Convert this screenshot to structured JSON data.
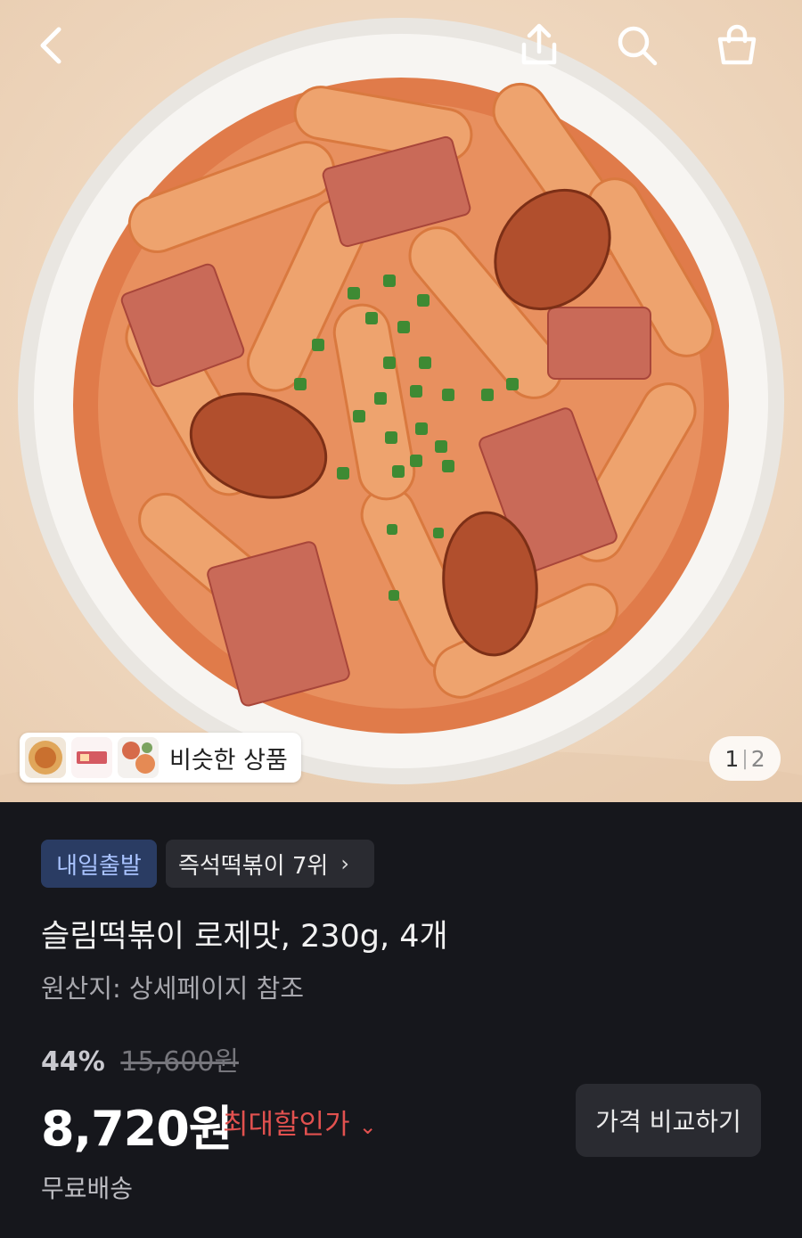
{
  "header": {
    "back_icon": "chevron-left-icon",
    "share_icon": "share-icon",
    "search_icon": "search-icon",
    "cart_icon": "shopping-bag-icon"
  },
  "hero": {
    "similar_products_label": "비슷한 상품",
    "page_current": "1",
    "page_separator": "|",
    "page_total": "2"
  },
  "badges": {
    "shipping": "내일출발",
    "ranking": "즉석떡볶이 7위",
    "ranking_chevron": "›"
  },
  "product": {
    "title": "슬림떡볶이 로제맛, 230g, 4개",
    "origin": "원산지: 상세페이지 참조"
  },
  "pricing": {
    "discount_percent": "44%",
    "original_price": "15,600원",
    "price": "8,720원",
    "max_discount_label": "최대할인가",
    "max_discount_chevron": "⌄",
    "compare_button": "가격 비교하기",
    "delivery": "무료배송"
  },
  "colors": {
    "background": "#16171c",
    "discount_accent": "#e2514f",
    "shipping_badge_bg": "#2a3c63",
    "shipping_badge_text": "#a9c3ff"
  }
}
